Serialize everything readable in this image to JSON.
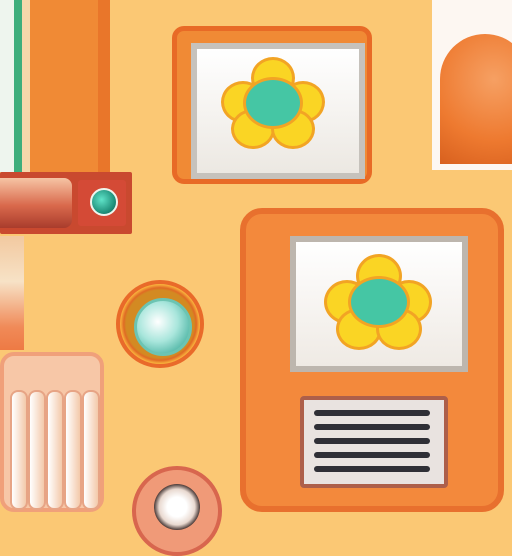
{
  "scene": {
    "description_colors": {
      "background": "#fbc874",
      "primary_orange": "#f08a35",
      "petal_yellow": "#fad524",
      "flower_center_teal": "#45c6a4",
      "indicator_teal": "#1f8f7a"
    }
  },
  "objects": {
    "top_screen_icon": "flower-icon",
    "machine_screen_icon": "flower-icon",
    "round_button_icon": "lens-icon",
    "indicator_icon": "light-icon"
  }
}
